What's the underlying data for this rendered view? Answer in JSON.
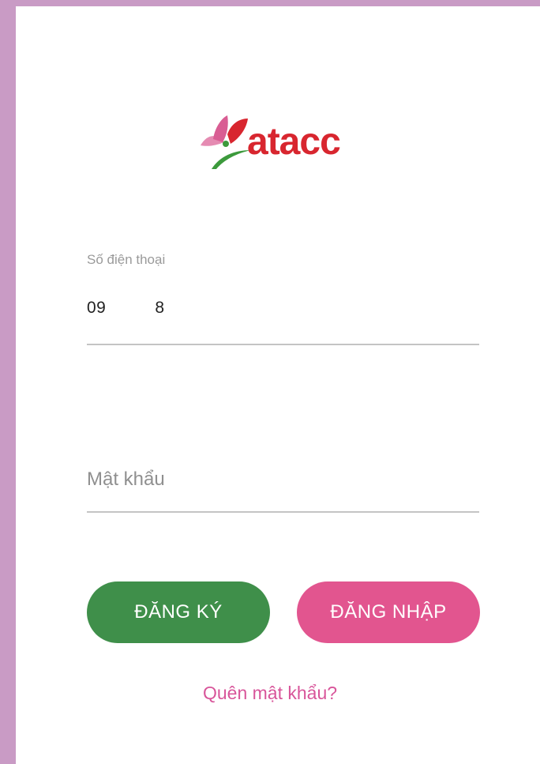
{
  "app": {
    "logo_text": "atacc",
    "brand_color": "#d8262f"
  },
  "form": {
    "phone": {
      "label": "Số điện thoại",
      "value_start": "09",
      "value_end": "8"
    },
    "password": {
      "placeholder": "Mật khẩu"
    },
    "register_label": "ĐĂNG KÝ",
    "login_label": "ĐĂNG NHẬP",
    "forgot_label": "Quên mật khẩu?"
  },
  "colors": {
    "frame": "#c99bc5",
    "register_button": "#3f8f4a",
    "login_button": "#e2558f",
    "link": "#d8559a"
  },
  "icons": {
    "logo_mark": "lotus-flower-icon"
  }
}
